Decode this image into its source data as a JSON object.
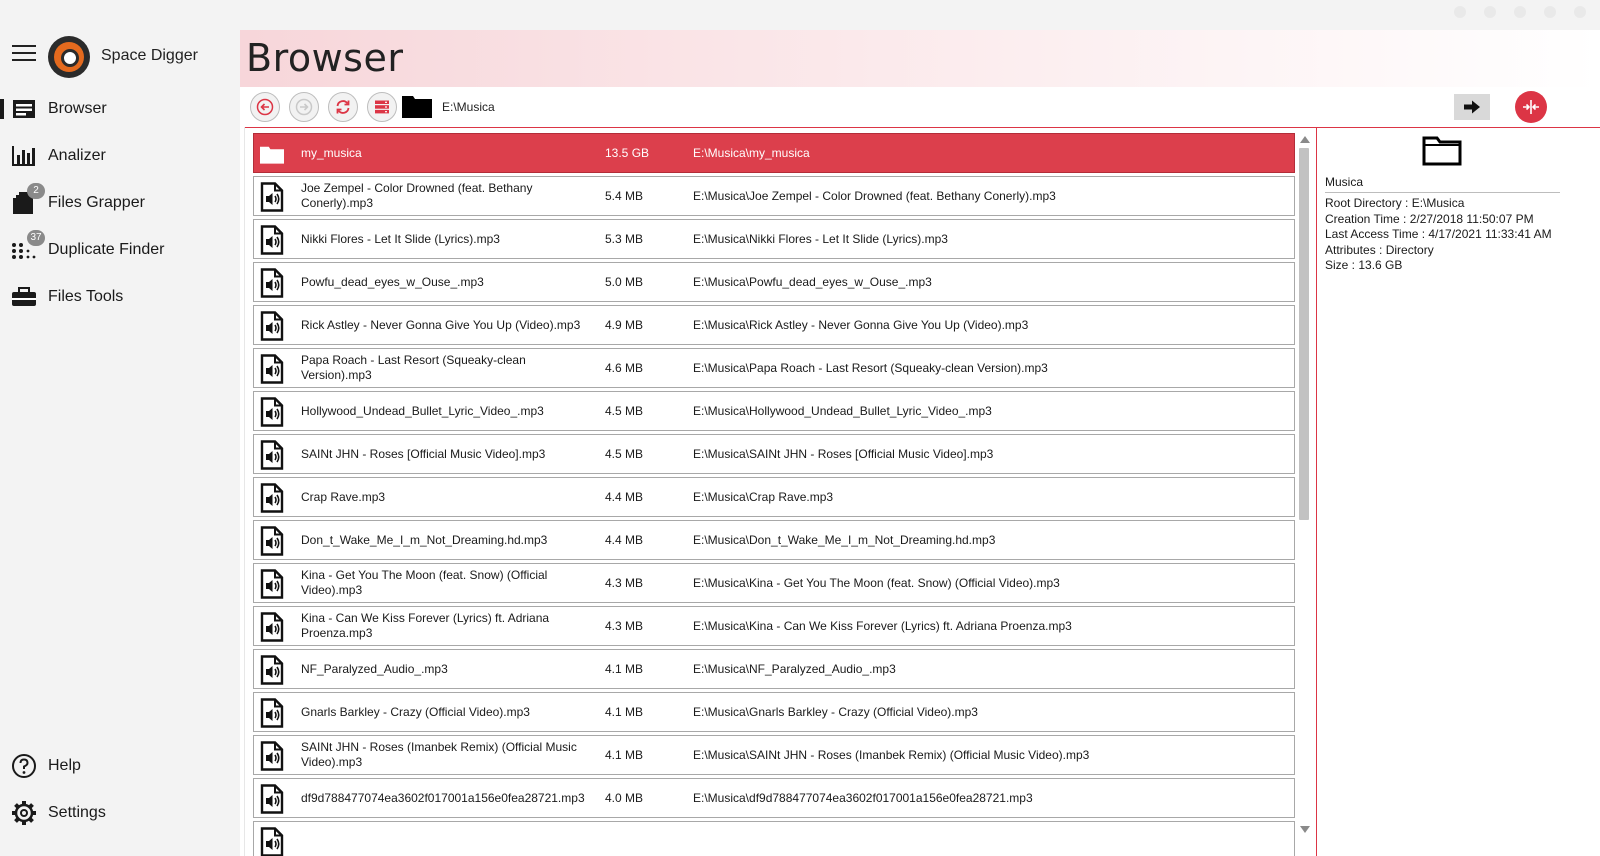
{
  "app": {
    "name": "Space Digger"
  },
  "sidebar": {
    "items": [
      {
        "label": "Browser",
        "icon": "browser-icon",
        "active": true,
        "badge": null
      },
      {
        "label": "Analizer",
        "icon": "bar-chart-icon",
        "active": false,
        "badge": null
      },
      {
        "label": "Files Grapper",
        "icon": "files-icon",
        "active": false,
        "badge": "2"
      },
      {
        "label": "Duplicate Finder",
        "icon": "dots-grid-icon",
        "active": false,
        "badge": "37"
      },
      {
        "label": "Files Tools",
        "icon": "toolbox-icon",
        "active": false,
        "badge": null
      }
    ],
    "bottom_items": [
      {
        "label": "Help",
        "icon": "help-icon"
      },
      {
        "label": "Settings",
        "icon": "gear-icon"
      }
    ]
  },
  "page": {
    "title": "Browser"
  },
  "toolbar": {
    "path": "E:\\Musica"
  },
  "files": [
    {
      "name": "my_musica",
      "size": "13.5 GB",
      "path": "E:\\Musica\\my_musica",
      "type": "folder",
      "selected": true
    },
    {
      "name": "Joe Zempel - Color Drowned (feat. Bethany Conerly).mp3",
      "size": "5.4 MB",
      "path": "E:\\Musica\\Joe Zempel - Color Drowned (feat. Bethany Conerly).mp3",
      "type": "audio",
      "selected": false
    },
    {
      "name": "Nikki Flores - Let It Slide (Lyrics).mp3",
      "size": "5.3 MB",
      "path": "E:\\Musica\\Nikki Flores - Let It Slide (Lyrics).mp3",
      "type": "audio",
      "selected": false
    },
    {
      "name": "Powfu_dead_eyes_w_Ouse_.mp3",
      "size": "5.0 MB",
      "path": "E:\\Musica\\Powfu_dead_eyes_w_Ouse_.mp3",
      "type": "audio",
      "selected": false
    },
    {
      "name": "Rick Astley - Never Gonna Give You Up (Video).mp3",
      "size": "4.9 MB",
      "path": "E:\\Musica\\Rick Astley - Never Gonna Give You Up (Video).mp3",
      "type": "audio",
      "selected": false
    },
    {
      "name": "Papa Roach - Last Resort (Squeaky-clean Version).mp3",
      "size": "4.6 MB",
      "path": "E:\\Musica\\Papa Roach - Last Resort (Squeaky-clean Version).mp3",
      "type": "audio",
      "selected": false
    },
    {
      "name": "Hollywood_Undead_Bullet_Lyric_Video_.mp3",
      "size": "4.5 MB",
      "path": "E:\\Musica\\Hollywood_Undead_Bullet_Lyric_Video_.mp3",
      "type": "audio",
      "selected": false
    },
    {
      "name": "SAINt JHN - Roses [Official Music Video].mp3",
      "size": "4.5 MB",
      "path": "E:\\Musica\\SAINt JHN - Roses [Official Music Video].mp3",
      "type": "audio",
      "selected": false
    },
    {
      "name": "Crap Rave.mp3",
      "size": "4.4 MB",
      "path": "E:\\Musica\\Crap Rave.mp3",
      "type": "audio",
      "selected": false
    },
    {
      "name": "Don_t_Wake_Me_I_m_Not_Dreaming.hd.mp3",
      "size": "4.4 MB",
      "path": "E:\\Musica\\Don_t_Wake_Me_I_m_Not_Dreaming.hd.mp3",
      "type": "audio",
      "selected": false
    },
    {
      "name": "Kina - Get You The Moon (feat. Snow) (Official Video).mp3",
      "size": "4.3 MB",
      "path": "E:\\Musica\\Kina - Get You The Moon (feat. Snow) (Official Video).mp3",
      "type": "audio",
      "selected": false
    },
    {
      "name": "Kina - Can We Kiss Forever (Lyrics) ft. Adriana Proenza.mp3",
      "size": "4.3 MB",
      "path": "E:\\Musica\\Kina - Can We Kiss Forever (Lyrics) ft. Adriana Proenza.mp3",
      "type": "audio",
      "selected": false
    },
    {
      "name": "NF_Paralyzed_Audio_.mp3",
      "size": "4.1 MB",
      "path": "E:\\Musica\\NF_Paralyzed_Audio_.mp3",
      "type": "audio",
      "selected": false
    },
    {
      "name": "Gnarls Barkley - Crazy (Official Video).mp3",
      "size": "4.1 MB",
      "path": "E:\\Musica\\Gnarls Barkley - Crazy (Official Video).mp3",
      "type": "audio",
      "selected": false
    },
    {
      "name": "SAINt JHN - Roses (Imanbek Remix) (Official Music Video).mp3",
      "size": "4.1 MB",
      "path": "E:\\Musica\\SAINt JHN - Roses (Imanbek Remix) (Official Music Video).mp3",
      "type": "audio",
      "selected": false
    },
    {
      "name": "df9d788477074ea3602f017001a156e0fea28721.mp3",
      "size": "4.0 MB",
      "path": "E:\\Musica\\df9d788477074ea3602f017001a156e0fea28721.mp3",
      "type": "audio",
      "selected": false
    },
    {
      "name": "",
      "size": "",
      "path": "",
      "type": "audio",
      "selected": false
    }
  ],
  "details": {
    "name": "Musica",
    "root_directory": "Root Directory  : E:\\Musica",
    "creation_time": "Creation Time  : 2/27/2018 11:50:07 PM",
    "last_access_time": "Last Access Time  : 4/17/2021 11:33:41 AM",
    "attributes": "Attributes  : Directory",
    "size": "Size  : 13.6 GB"
  },
  "colors": {
    "accent": "#dc3545",
    "selected_row": "#dc3f4c",
    "sidebar_bg": "#f3f3f3"
  }
}
